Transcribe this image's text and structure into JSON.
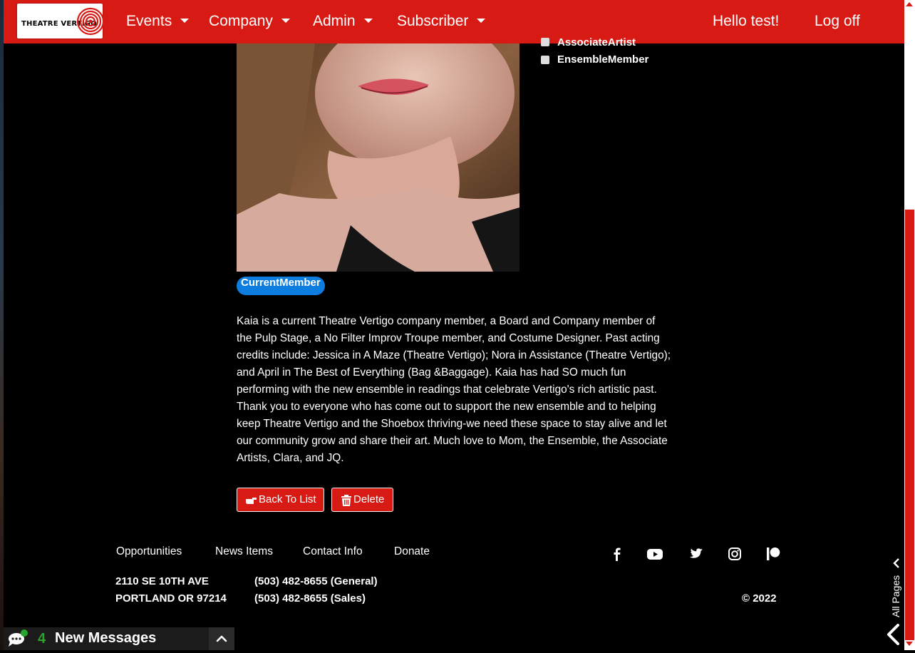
{
  "nav": {
    "logo_text": "THEATRE VERTIGO",
    "menus": [
      {
        "label": "Events"
      },
      {
        "label": "Company"
      },
      {
        "label": "Admin"
      },
      {
        "label": "Subscriber"
      }
    ],
    "greeting": "Hello test!",
    "logoff": "Log off"
  },
  "roles": {
    "items": [
      {
        "label": "AssociateArtist",
        "checked": false
      },
      {
        "label": "EnsembleMember",
        "checked": false
      }
    ]
  },
  "profile": {
    "status_badge": "CurrentMember",
    "bio": "Kaia is a current Theatre Vertigo company member, a Board and Company member of the Pulp Stage, a No Filter Improv Troupe member, and Costume Designer. Past acting credits include: Jessica in A Maze (Theatre Vertigo); Nora in Assistance (Theatre Vertigo); and April in The Best of Everything (Bag &Baggage). Kaia has had SO much fun performing with the new ensemble in readings that celebrate Vertigo's rich artistic past. Thank you to everyone who has come out to support the new ensemble and to helping keep Theatre Vertigo and the Shoebox thriving-we need these space to stay alive and let our community grow and share their art. Much love to Mom, the Ensemble, the Associate Artists, Clara, and JQ."
  },
  "actions": {
    "back_label": "Back To List",
    "delete_label": "Delete"
  },
  "footer": {
    "links": [
      "Opportunities",
      "News Items",
      "Contact Info",
      "Donate"
    ],
    "social_icons": [
      "facebook-icon",
      "youtube-icon",
      "twitter-icon",
      "instagram-icon",
      "patreon-icon"
    ],
    "address_line1": "2110 SE 10TH AVE",
    "address_line2": "PORTLAND OR 97214",
    "phone_general": "(503) 482-8655 (General)",
    "phone_sales": "(503) 482-8655 (Sales)",
    "copyright": "© 2022"
  },
  "messages": {
    "count": "4",
    "label": "New Messages"
  },
  "side_panel": {
    "label": "All Pages"
  },
  "colors": {
    "brand_red": "#d81a14",
    "badge_blue": "#0d7de0",
    "message_green": "#2aa52a"
  }
}
